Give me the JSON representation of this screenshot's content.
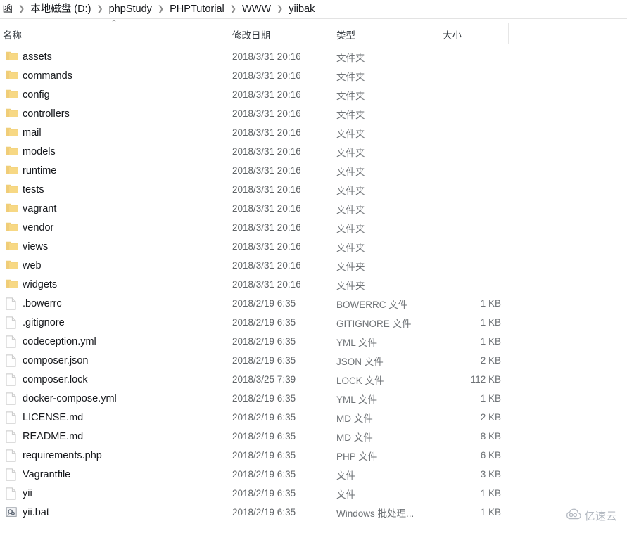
{
  "breadcrumb": {
    "items": [
      {
        "label": "函",
        "clipped": true
      },
      {
        "label": "本地磁盘 (D:)",
        "clipped": false
      },
      {
        "label": "phpStudy",
        "clipped": false
      },
      {
        "label": "PHPTutorial",
        "clipped": false
      },
      {
        "label": "WWW",
        "clipped": false
      },
      {
        "label": "yiibak",
        "clipped": false
      }
    ],
    "separator": "❯"
  },
  "columns": {
    "name": "名称",
    "date_modified": "修改日期",
    "type": "类型",
    "size": "大小",
    "sort_caret": "⌃"
  },
  "files": [
    {
      "icon": "folder-icon",
      "name": "assets",
      "date": "2018/3/31 20:16",
      "type": "文件夹",
      "size": ""
    },
    {
      "icon": "folder-icon",
      "name": "commands",
      "date": "2018/3/31 20:16",
      "type": "文件夹",
      "size": ""
    },
    {
      "icon": "folder-icon",
      "name": "config",
      "date": "2018/3/31 20:16",
      "type": "文件夹",
      "size": ""
    },
    {
      "icon": "folder-icon",
      "name": "controllers",
      "date": "2018/3/31 20:16",
      "type": "文件夹",
      "size": ""
    },
    {
      "icon": "folder-icon",
      "name": "mail",
      "date": "2018/3/31 20:16",
      "type": "文件夹",
      "size": ""
    },
    {
      "icon": "folder-icon",
      "name": "models",
      "date": "2018/3/31 20:16",
      "type": "文件夹",
      "size": ""
    },
    {
      "icon": "folder-icon",
      "name": "runtime",
      "date": "2018/3/31 20:16",
      "type": "文件夹",
      "size": ""
    },
    {
      "icon": "folder-icon",
      "name": "tests",
      "date": "2018/3/31 20:16",
      "type": "文件夹",
      "size": ""
    },
    {
      "icon": "folder-icon",
      "name": "vagrant",
      "date": "2018/3/31 20:16",
      "type": "文件夹",
      "size": ""
    },
    {
      "icon": "folder-icon",
      "name": "vendor",
      "date": "2018/3/31 20:16",
      "type": "文件夹",
      "size": ""
    },
    {
      "icon": "folder-icon",
      "name": "views",
      "date": "2018/3/31 20:16",
      "type": "文件夹",
      "size": ""
    },
    {
      "icon": "folder-icon",
      "name": "web",
      "date": "2018/3/31 20:16",
      "type": "文件夹",
      "size": ""
    },
    {
      "icon": "folder-icon",
      "name": "widgets",
      "date": "2018/3/31 20:16",
      "type": "文件夹",
      "size": ""
    },
    {
      "icon": "file-icon",
      "name": ".bowerrc",
      "date": "2018/2/19 6:35",
      "type": "BOWERRC 文件",
      "size": "1 KB"
    },
    {
      "icon": "file-icon",
      "name": ".gitignore",
      "date": "2018/2/19 6:35",
      "type": "GITIGNORE 文件",
      "size": "1 KB"
    },
    {
      "icon": "file-icon",
      "name": "codeception.yml",
      "date": "2018/2/19 6:35",
      "type": "YML 文件",
      "size": "1 KB"
    },
    {
      "icon": "file-icon",
      "name": "composer.json",
      "date": "2018/2/19 6:35",
      "type": "JSON 文件",
      "size": "2 KB"
    },
    {
      "icon": "file-icon",
      "name": "composer.lock",
      "date": "2018/3/25 7:39",
      "type": "LOCK 文件",
      "size": "112 KB"
    },
    {
      "icon": "file-icon",
      "name": "docker-compose.yml",
      "date": "2018/2/19 6:35",
      "type": "YML 文件",
      "size": "1 KB"
    },
    {
      "icon": "file-icon",
      "name": "LICENSE.md",
      "date": "2018/2/19 6:35",
      "type": "MD 文件",
      "size": "2 KB"
    },
    {
      "icon": "file-icon",
      "name": "README.md",
      "date": "2018/2/19 6:35",
      "type": "MD 文件",
      "size": "8 KB"
    },
    {
      "icon": "file-icon",
      "name": "requirements.php",
      "date": "2018/2/19 6:35",
      "type": "PHP 文件",
      "size": "6 KB"
    },
    {
      "icon": "file-icon",
      "name": "Vagrantfile",
      "date": "2018/2/19 6:35",
      "type": "文件",
      "size": "3 KB"
    },
    {
      "icon": "file-icon",
      "name": "yii",
      "date": "2018/2/19 6:35",
      "type": "文件",
      "size": "1 KB"
    },
    {
      "icon": "bat-icon",
      "name": "yii.bat",
      "date": "2018/2/19 6:35",
      "type": "Windows 批处理...",
      "size": "1 KB"
    }
  ],
  "watermark": {
    "text": "亿速云",
    "logo": "cloud-icon"
  },
  "colors": {
    "folder": "#f7d884",
    "folder_tab": "#e8c56a",
    "file_outline": "#c8c8c8",
    "text_primary": "#16181c",
    "text_secondary": "#6e7276",
    "divider": "#e3e3e3",
    "watermark": "#a8aeb8"
  }
}
